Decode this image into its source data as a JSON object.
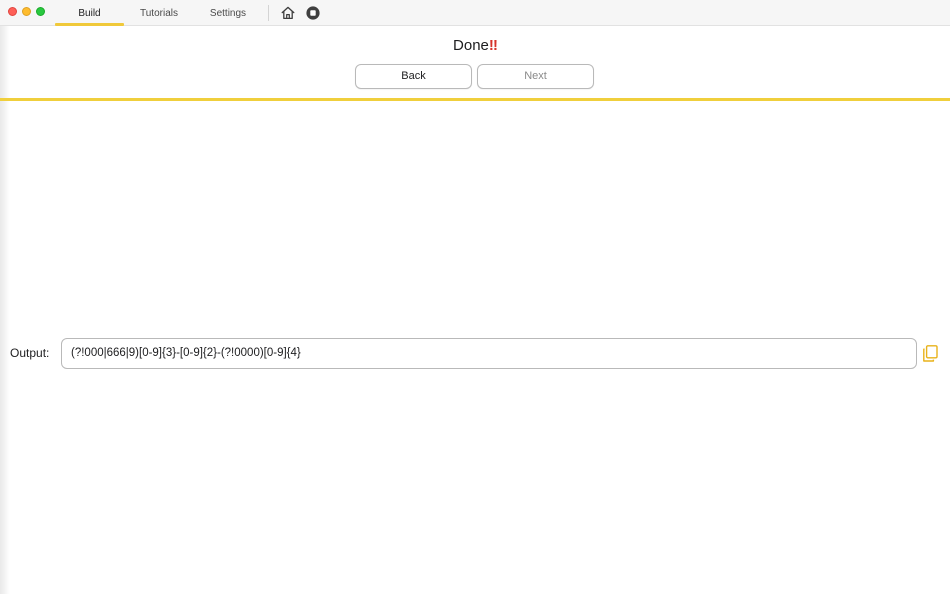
{
  "tabs": [
    {
      "label": "Build",
      "selected": true
    },
    {
      "label": "Tutorials",
      "selected": false
    },
    {
      "label": "Settings",
      "selected": false
    }
  ],
  "toolbar": {
    "home_icon": "house-icon",
    "stop_icon": "stop-circle-icon"
  },
  "page": {
    "title": "Done",
    "title_emphasis": "‼"
  },
  "buttons": {
    "back": "Back",
    "next": "Next"
  },
  "output": {
    "label": "Output:",
    "value": "(?!000|666|9)[0-9]{3}-[0-9]{2}-(?!0000)[0-9]{4}",
    "copy_icon": "copy-icon"
  },
  "colors": {
    "accent": "#f0cf3c",
    "tab_underline": "#f0c93a",
    "alert": "#d6332a",
    "copy_icon": "#e8b21a"
  }
}
